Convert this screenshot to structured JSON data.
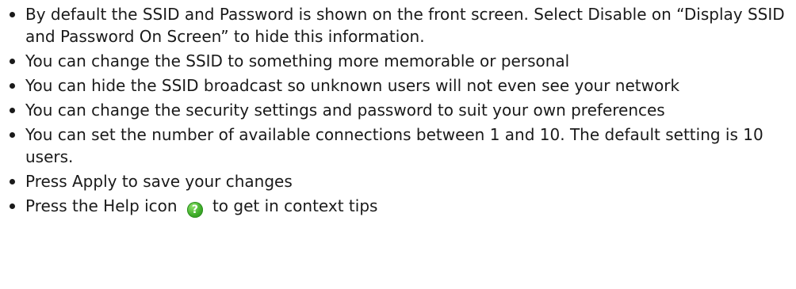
{
  "bullets": [
    "By default the SSID and Password is shown on the front screen. Select Disable on “Display SSID and Password On Screen” to hide this information.",
    "You can change the SSID to something more memorable or personal",
    "You can hide the SSID broadcast so unknown users will not even see your network",
    "You can change the security settings and password to suit your own preferences",
    "You can set the number of available connections between 1 and 10. The default setting is 10 users.",
    "Press Apply to save your changes"
  ],
  "help_bullet": {
    "before": "Press the Help icon",
    "icon": "help-question-icon",
    "icon_glyph": "?",
    "after": "to get in context tips"
  }
}
